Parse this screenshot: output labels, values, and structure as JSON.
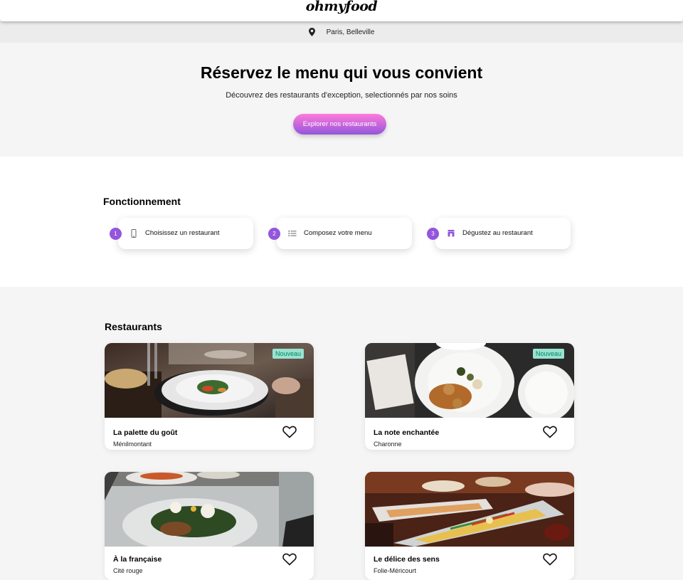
{
  "header": {
    "logo": "ohmyfood"
  },
  "location": {
    "icon": "map-pin-icon",
    "text": "Paris, Belleville"
  },
  "hero": {
    "title": "Réservez le menu qui vous convient",
    "subtitle": "Découvrez des restaurants d'exception, selectionnés par nos soins",
    "cta_label": "Explorer nos restaurants"
  },
  "how": {
    "title": "Fonctionnement",
    "steps": [
      {
        "num": "1",
        "icon": "mobile-phone-icon",
        "label": "Choisissez un restaurant"
      },
      {
        "num": "2",
        "icon": "list-icon",
        "label": "Composez votre menu"
      },
      {
        "num": "3",
        "icon": "store-icon",
        "label": "Dégustez au restaurant"
      }
    ]
  },
  "restaurants": {
    "title": "Restaurants",
    "items": [
      {
        "name": "La palette du goût",
        "area": "Ménilmontant",
        "badge": "Nouveau"
      },
      {
        "name": "La note enchantée",
        "area": "Charonne",
        "badge": "Nouveau"
      },
      {
        "name": "À la française",
        "area": "Cité rouge",
        "badge": ""
      },
      {
        "name": "Le délice des sens",
        "area": "Folie-Méricourt",
        "badge": ""
      }
    ]
  },
  "colors": {
    "accent_start": "#ff79da",
    "accent_end": "#9356dc",
    "badge_bg": "#99e2d0",
    "badge_text": "#008766"
  }
}
